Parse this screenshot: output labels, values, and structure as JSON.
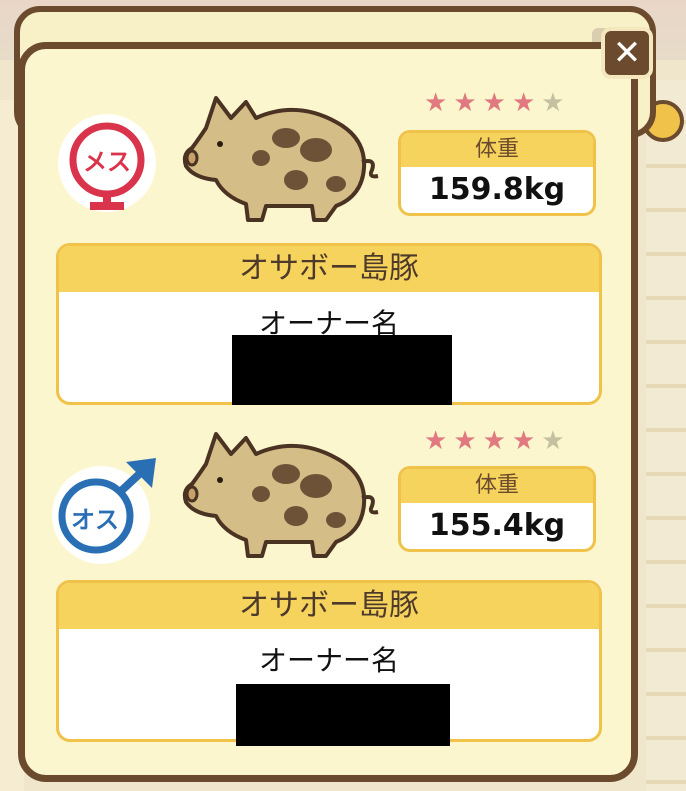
{
  "dialog": {
    "close_label": "✕"
  },
  "pigs": [
    {
      "gender": "female",
      "gender_label": "メス",
      "gender_color": "#d9344b",
      "rating": 4,
      "rating_max": 5,
      "weight_label": "体重",
      "weight_value": "159.8kg",
      "breed": "オサボー島豚",
      "owner_label": "オーナー名"
    },
    {
      "gender": "male",
      "gender_label": "オス",
      "gender_color": "#2a6fb4",
      "rating": 4,
      "rating_max": 5,
      "weight_label": "体重",
      "weight_value": "155.4kg",
      "breed": "オサボー島豚",
      "owner_label": "オーナー名"
    }
  ],
  "colors": {
    "frame": "#6b4a2e",
    "panel": "#fbf6cd",
    "accent_yellow": "#f6d35c",
    "star_on": "#e07a80",
    "star_off": "#c4c0a0"
  }
}
